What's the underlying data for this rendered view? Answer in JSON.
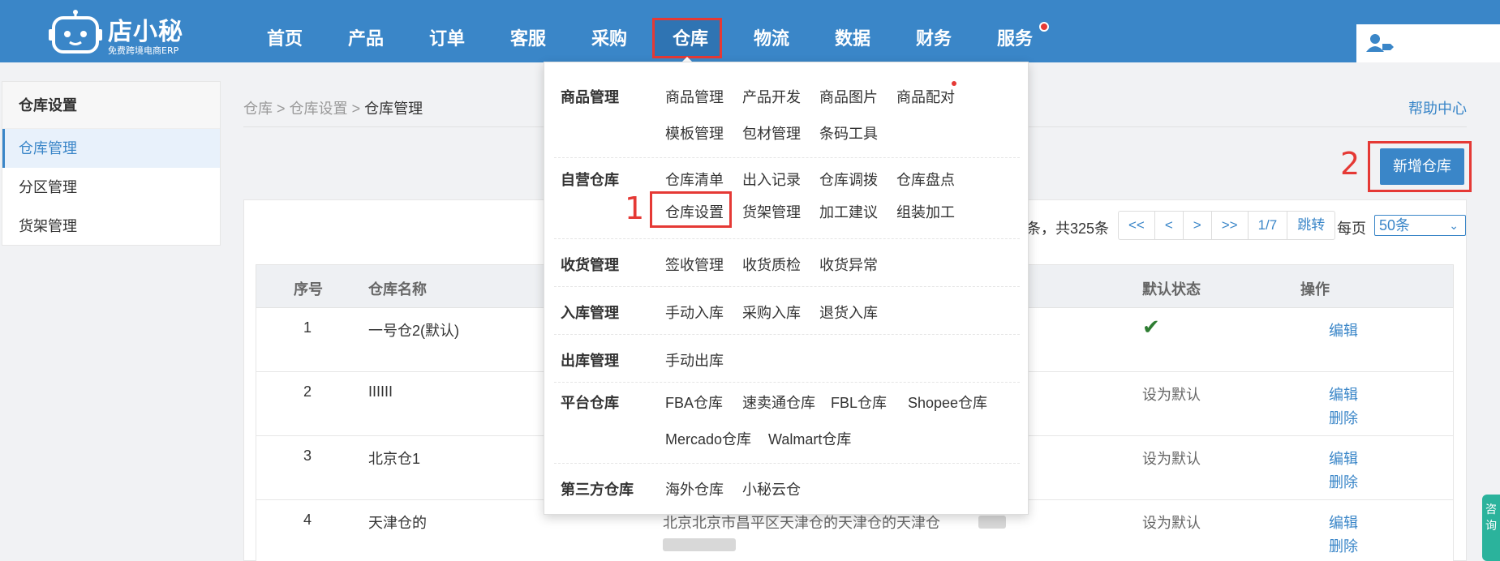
{
  "brand": {
    "name": "店小秘",
    "slogan": "免费跨境电商ERP"
  },
  "nav": [
    "首页",
    "产品",
    "订单",
    "客服",
    "采购",
    "仓库",
    "物流",
    "数据",
    "财务",
    "服务"
  ],
  "side_tab": "咨询",
  "sidebar": {
    "title": "仓库设置",
    "items": [
      "仓库管理",
      "分区管理",
      "货架管理"
    ]
  },
  "breadcrumb": {
    "items": [
      "仓库",
      ">",
      "仓库设置",
      ">"
    ],
    "current": "仓库管理"
  },
  "help_label": "帮助中心",
  "annotations": {
    "one": "1",
    "two": "2"
  },
  "add_button": "新增仓库",
  "pager": {
    "summary": "条，共325条",
    "buttons": [
      "<<",
      "<",
      ">",
      ">>",
      "1/7",
      "跳转"
    ],
    "per_page_label": "每页",
    "per_page_value": "50条"
  },
  "table": {
    "headers": {
      "index": "序号",
      "name": "仓库名称",
      "default": "默认状态",
      "action": "操作"
    },
    "rows": [
      {
        "index": "1",
        "name": "一号仓2(默认)",
        "address": "",
        "default": "✔",
        "actions": [
          "编辑"
        ]
      },
      {
        "index": "2",
        "name": "IIIIII",
        "address": "",
        "default": "设为默认",
        "actions": [
          "编辑",
          "删除"
        ]
      },
      {
        "index": "3",
        "name": "北京仓1",
        "address": "",
        "default": "设为默认",
        "actions": [
          "编辑",
          "删除"
        ]
      },
      {
        "index": "4",
        "name": "天津仓的",
        "address": "北京北京市昌平区天津仓的天津仓的天津仓",
        "default": "设为默认",
        "actions": [
          "编辑",
          "删除"
        ]
      }
    ]
  },
  "dropdown": {
    "sections": [
      {
        "head": "商品管理",
        "links": [
          "商品管理",
          "产品开发",
          "商品图片",
          "商品配对",
          "模板管理",
          "包材管理",
          "条码工具"
        ]
      },
      {
        "head": "自营仓库",
        "links": [
          "仓库清单",
          "出入记录",
          "仓库调拨",
          "仓库盘点",
          "仓库设置",
          "货架管理",
          "加工建议",
          "组装加工"
        ]
      },
      {
        "head": "收货管理",
        "links": [
          "签收管理",
          "收货质检",
          "收货异常"
        ]
      },
      {
        "head": "入库管理",
        "links": [
          "手动入库",
          "采购入库",
          "退货入库"
        ]
      },
      {
        "head": "出库管理",
        "links": [
          "手动出库"
        ]
      },
      {
        "head": "平台仓库",
        "links": [
          "FBA仓库",
          "速卖通仓库",
          "FBL仓库",
          "Shopee仓库",
          "Mercado仓库",
          "Walmart仓库"
        ]
      },
      {
        "head": "第三方仓库",
        "links": [
          "海外仓库",
          "小秘云仓"
        ]
      }
    ]
  },
  "colors": {
    "primary": "#3a86c8",
    "highlight": "#e53935",
    "check": "#2e7d32"
  }
}
